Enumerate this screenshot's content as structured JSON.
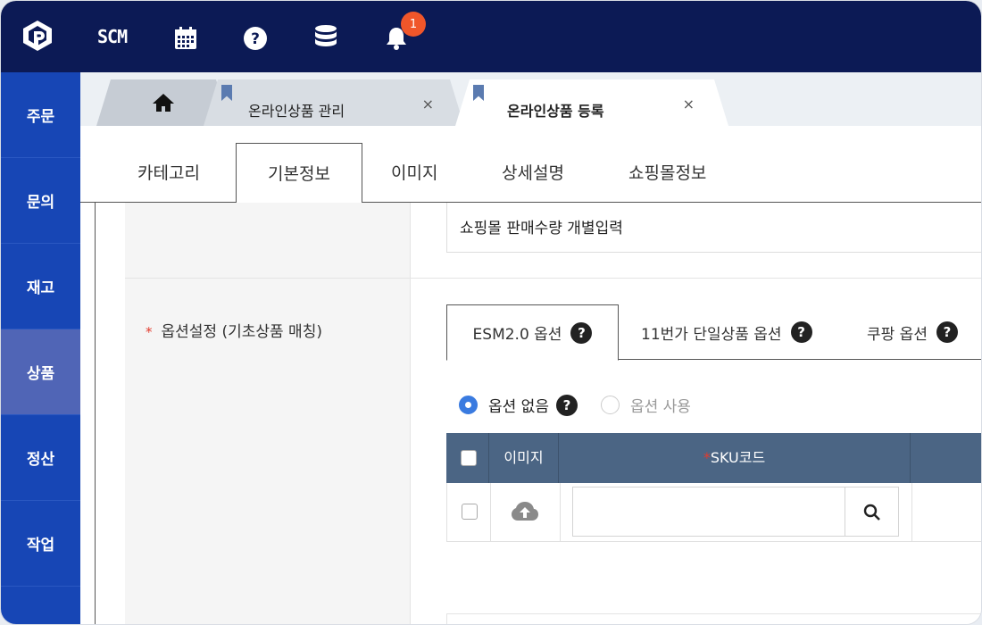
{
  "topbar": {
    "scm_label": "SCM",
    "notification_count": "1",
    "icons": [
      "logo-icon",
      "calendar-icon",
      "help-icon",
      "database-icon",
      "bell-icon"
    ],
    "background": "#0c1a55",
    "badge_color": "#f0562a"
  },
  "sidebar": {
    "items": [
      {
        "label": "주문"
      },
      {
        "label": "문의"
      },
      {
        "label": "재고"
      },
      {
        "label": "상품",
        "active": true
      },
      {
        "label": "정산"
      },
      {
        "label": "작업"
      }
    ],
    "background": "#1746b5",
    "active_background": "#5065b6"
  },
  "tabs": {
    "items": [
      {
        "label": "온라인상품 관리",
        "close": "×"
      },
      {
        "label": "온라인상품 등록",
        "close": "×",
        "active": true
      }
    ]
  },
  "subtabs": {
    "items": [
      "카테고리",
      "기본정보",
      "이미지",
      "상세설명",
      "쇼핑몰정보"
    ],
    "active": "기본정보"
  },
  "form": {
    "field1_value": "쇼핑몰 판매수량 개별입력",
    "required_mark": "*",
    "option_label": "옵션설정 (기초상품 매칭)",
    "option_tabs": [
      "ESM2.0 옵션",
      "11번가 단일상품 옵션",
      "쿠팡 옵션"
    ],
    "radio_none": "옵션 없음",
    "radio_use": "옵션 사용",
    "grid": {
      "header_image": "이미지",
      "header_sku": "SKU코드",
      "header_required": "*"
    }
  },
  "colors": {
    "accent": "#3a7be0",
    "grid_header": "#4b6584",
    "required": "#e23b2e"
  }
}
